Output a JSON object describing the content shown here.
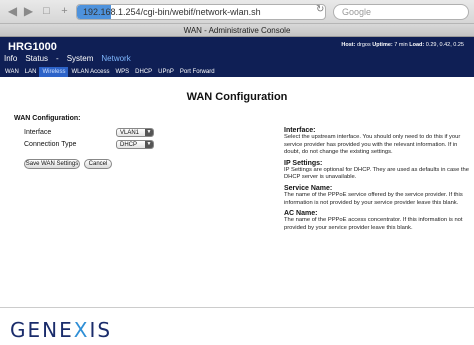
{
  "browser": {
    "url_prefix": "192.168.1.254",
    "url_rest": "/cgi-bin/webif/network-wlan.sh",
    "search_placeholder": "Google"
  },
  "window": {
    "title": "WAN - Administrative Console"
  },
  "header": {
    "model": "HRG1000",
    "host_label": "Host:",
    "host_value": "drgos",
    "uptime_label": "Uptime:",
    "uptime_value": "7 min",
    "load_label": "Load:",
    "load_value": "0.29, 0.42, 0.25"
  },
  "main_menu": [
    "Info",
    "Status",
    "-",
    "System",
    "Network"
  ],
  "main_menu_active": "Network",
  "sub_menu": [
    "WAN",
    "LAN",
    "Wireless",
    "WLAN Access",
    "WPS",
    "DHCP",
    "UPnP",
    "Port Forward"
  ],
  "sub_menu_active": "Wireless",
  "page": {
    "title": "WAN Configuration",
    "section_title": "WAN Configuration:",
    "interface_label": "Interface",
    "interface_value": "VLAN1",
    "connection_label": "Connection Type",
    "connection_value": "DHCP",
    "save_button": "Save WAN Settings",
    "cancel_button": "Cancel"
  },
  "help": [
    {
      "heading": "Interface:",
      "text": "Select the upstream interface. You should only need to do this if your service provider has provided you with the relevant information. If in doubt, do not change the existing settings."
    },
    {
      "heading": "IP Settings:",
      "text": "IP Settings are optional for DHCP. They are used as defaults in case the DHCP server is unavailable."
    },
    {
      "heading": "Service Name:",
      "text": "The name of the PPPoE service offered by the service provider. If this information is not provided by your service provider leave this blank."
    },
    {
      "heading": "AC Name:",
      "text": "The name of the PPPoE access concentrator. If this information is not provided by your service provider leave this blank."
    }
  ],
  "logo": {
    "part1": "GENE",
    "part2": "X",
    "part3": "IS"
  },
  "colors": {
    "header_bg": "#0f1f55",
    "accent": "#2d63c8",
    "logo": "#1a2c6b"
  }
}
